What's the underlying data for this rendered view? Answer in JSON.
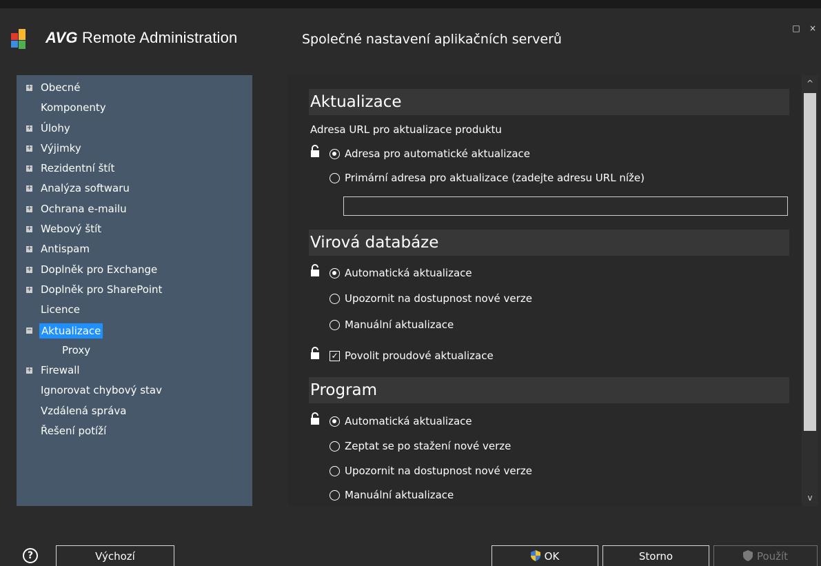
{
  "app": {
    "brand_bold": "AVG",
    "brand_rest": "Remote Administration",
    "dialog_title": "Společné nastavení aplikačních serverů"
  },
  "window_controls": {
    "maximize": "□",
    "close": "×"
  },
  "sidebar": {
    "items": [
      {
        "label": "Obecné",
        "expander": "+"
      },
      {
        "label": "Komponenty",
        "expander": ""
      },
      {
        "label": "Úlohy",
        "expander": "+"
      },
      {
        "label": "Výjimky",
        "expander": "+"
      },
      {
        "label": "Rezidentní štít",
        "expander": "+"
      },
      {
        "label": "Analýza softwaru",
        "expander": "+"
      },
      {
        "label": "Ochrana e-mailu",
        "expander": "+"
      },
      {
        "label": "Webový štít",
        "expander": "+"
      },
      {
        "label": "Antispam",
        "expander": "+"
      },
      {
        "label": "Doplněk pro Exchange",
        "expander": "+"
      },
      {
        "label": "Doplněk pro SharePoint",
        "expander": "+"
      },
      {
        "label": "Licence",
        "expander": ""
      },
      {
        "label": "Aktualizace",
        "expander": "−",
        "selected": true
      },
      {
        "label": "Proxy",
        "expander": "",
        "child": true
      },
      {
        "label": "Firewall",
        "expander": "+"
      },
      {
        "label": "Ignorovat chybový stav",
        "expander": ""
      },
      {
        "label": "Vzdálená správa",
        "expander": ""
      },
      {
        "label": "Řešení potíží",
        "expander": ""
      }
    ]
  },
  "content": {
    "section_update": {
      "title": "Aktualizace",
      "url_label": "Adresa URL pro aktualizace produktu",
      "opt_auto_address": "Adresa pro automatické aktualizace",
      "opt_primary_address": "Primární adresa pro aktualizace (zadejte adresu URL níže)",
      "url_value": ""
    },
    "section_virus": {
      "title": "Virová databáze",
      "opt_auto": "Automatická aktualizace",
      "opt_notify": "Upozornit na dostupnost nové verze",
      "opt_manual": "Manuální aktualizace",
      "chk_streaming": "Povolit proudové aktualizace"
    },
    "section_program": {
      "title": "Program",
      "opt_auto": "Automatická aktualizace",
      "opt_ask": "Zeptat se po stažení nové verze",
      "opt_notify": "Upozornit na dostupnost nové verze",
      "opt_manual": "Manuální aktualizace"
    }
  },
  "scrollbar": {
    "up": "^",
    "down": "v"
  },
  "footer": {
    "help": "?",
    "default_label": "Výchozí",
    "ok_label": "OK",
    "cancel_label": "Storno",
    "apply_label": "Použít"
  },
  "colors": {
    "sidebar_bg": "#465869",
    "selection": "#1e90ff",
    "section_head_bg": "#373737",
    "window_bg": "#2b2b2b"
  }
}
